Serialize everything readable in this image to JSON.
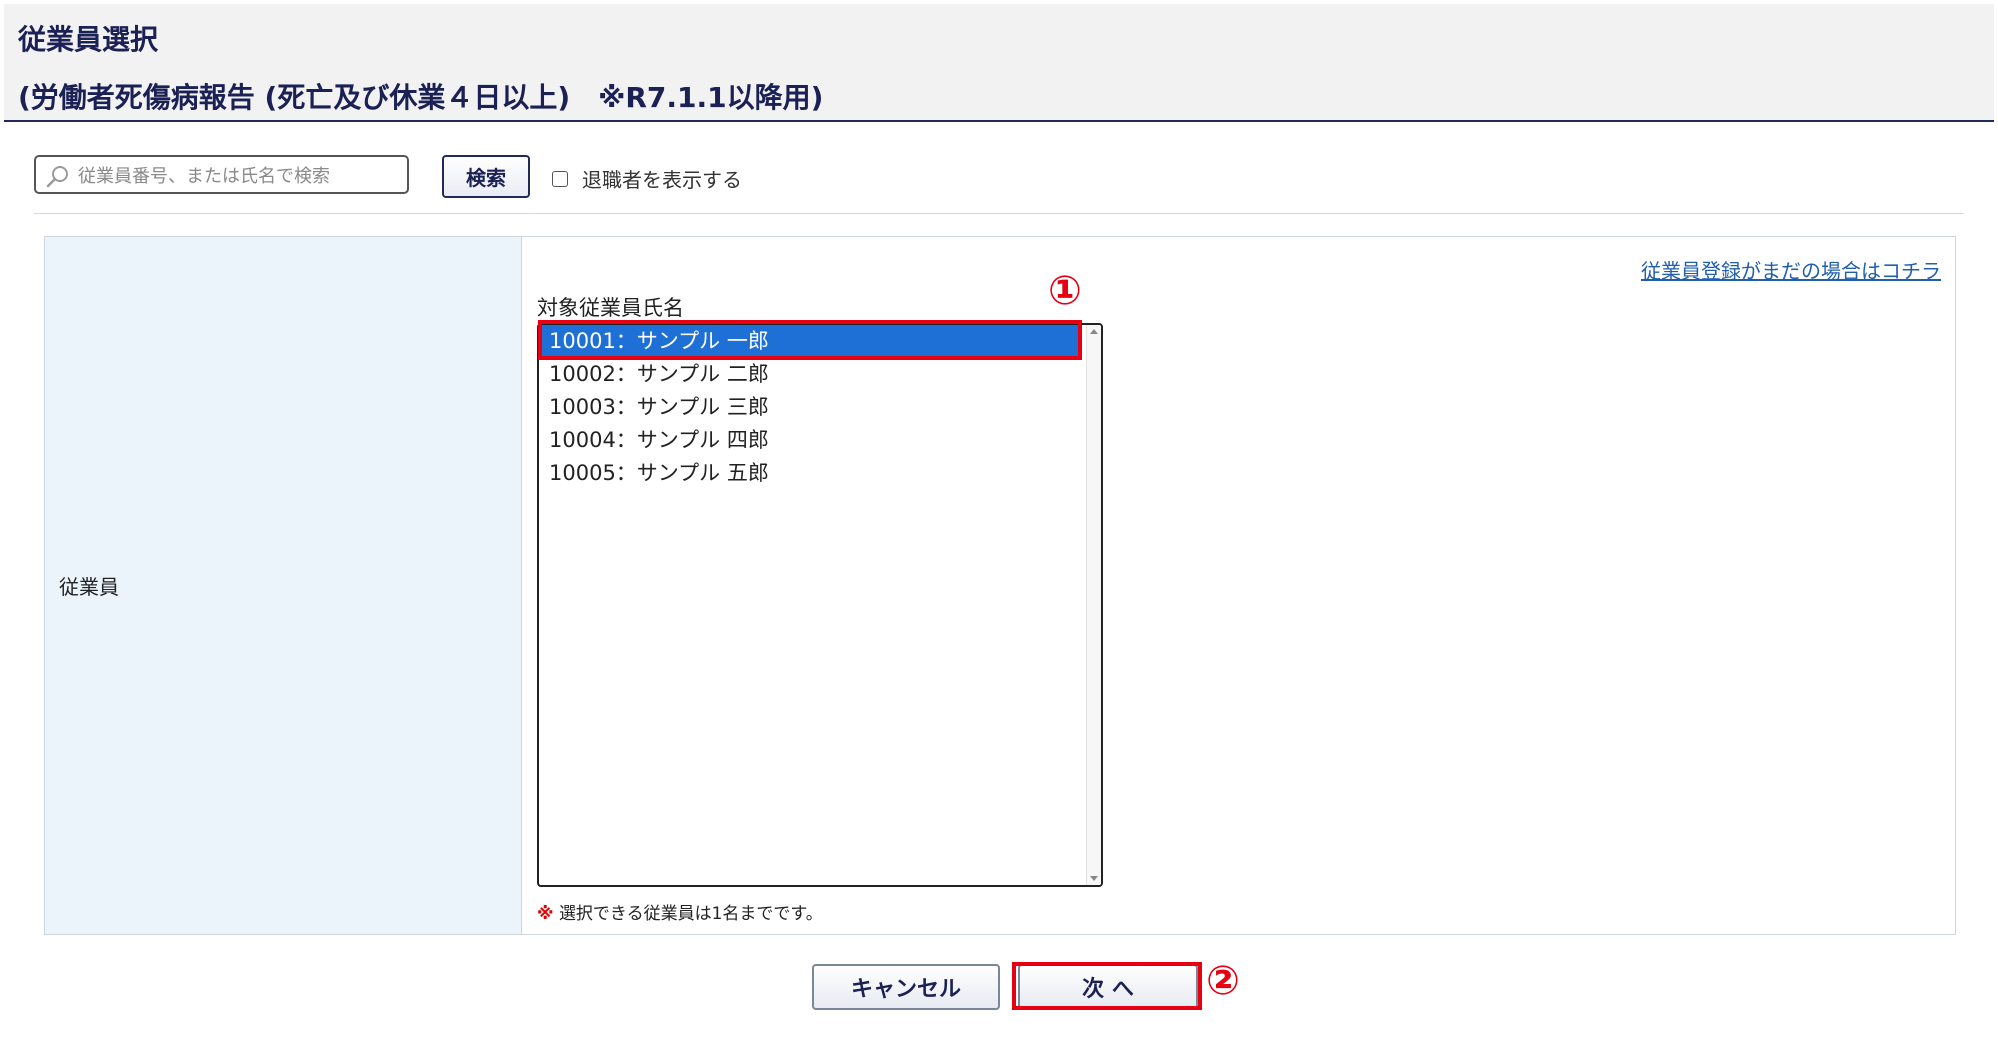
{
  "header": {
    "title": "従業員選択",
    "subtitle": "(労働者死傷病報告 (死亡及び休業４日以上)　※R7.1.1以降用)"
  },
  "search": {
    "placeholder": "従業員番号、または氏名で検索",
    "value": "",
    "button_label": "検索",
    "show_retired_label": "退職者を表示する",
    "show_retired_checked": false
  },
  "form": {
    "field_label": "従業員",
    "register_link": "従業員登録がまだの場合はコチラ",
    "list_caption": "対象従業員氏名",
    "employees": [
      {
        "label": "10001：サンプル 一郎",
        "selected": true
      },
      {
        "label": "10002：サンプル 二郎",
        "selected": false
      },
      {
        "label": "10003：サンプル 三郎",
        "selected": false
      },
      {
        "label": "10004：サンプル 四郎",
        "selected": false
      },
      {
        "label": "10005：サンプル 五郎",
        "selected": false
      }
    ],
    "note_mark": "※",
    "note_text": "選択できる従業員は1名までです。"
  },
  "annotations": {
    "marker1": "①",
    "marker2": "②",
    "highlight_color": "#e60012"
  },
  "buttons": {
    "cancel_label": "キャンセル",
    "next_label": "次 へ"
  },
  "colors": {
    "title": "#1c2155",
    "selection": "#1e6fd6",
    "link": "#1f5fae",
    "label_bg": "#ebf3fb"
  }
}
